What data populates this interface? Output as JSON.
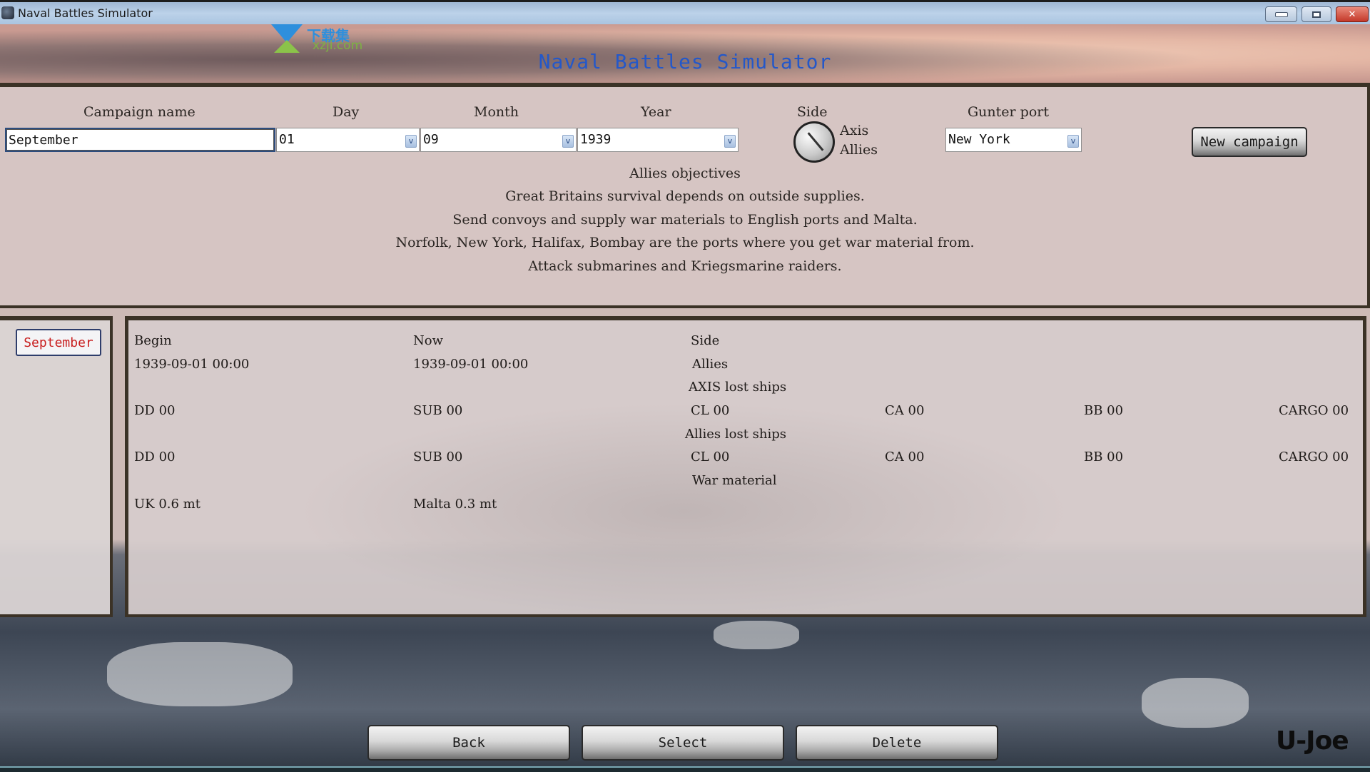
{
  "window": {
    "title": "Naval Battles Simulator",
    "controls": {
      "minimize": "minimize",
      "maximize": "maximize",
      "close": "✕"
    }
  },
  "watermark": {
    "chinese": "下载集",
    "url": "xzji.com"
  },
  "app_title": "Naval Battles Simulator",
  "campaign_form": {
    "labels": {
      "campaign_name": "Campaign name",
      "day": "Day",
      "month": "Month",
      "year": "Year",
      "side": "Side",
      "gunter_port": "Gunter port"
    },
    "campaign_name_value": "September",
    "day_value": "01",
    "month_value": "09",
    "year_value": "1939",
    "side_options": [
      "Axis",
      "Allies"
    ],
    "side_selected": "Allies",
    "gunter_port_value": "New York",
    "dropdown_glyph": "v",
    "new_campaign_label": "New campaign"
  },
  "objectives": {
    "heading": "Allies objectives",
    "lines": [
      "Great Britains survival depends on outside supplies.",
      "Send convoys and supply war materials to English ports and Malta.",
      "Norfolk, New York, Halifax, Bombay are the ports where you get war material from.",
      "Attack  submarines and Kriegsmarine raiders."
    ]
  },
  "campaign_list": [
    {
      "name": "September",
      "selected": true
    }
  ],
  "details": {
    "begin_label": "Begin",
    "now_label": "Now",
    "side_label": "Side",
    "begin_value": "1939-09-01  00:00",
    "now_value": "1939-09-01  00:00",
    "side_value": "Allies",
    "axis_lost_heading": "AXIS lost ships",
    "axis_lost": [
      "DD 00",
      "SUB 00",
      "CL 00",
      "CA 00",
      "BB 00",
      "CARGO 00"
    ],
    "allies_lost_heading": "Allies lost ships",
    "allies_lost": [
      "DD 00",
      "SUB 00",
      "CL 00",
      "CA 00",
      "BB 00",
      "CARGO 00"
    ],
    "war_material_heading": "War material",
    "war_material": [
      "UK 0.6 mt",
      "Malta 0.3 mt"
    ]
  },
  "buttons": {
    "back": "Back",
    "select": "Select",
    "delete": "Delete"
  },
  "author": "U-Joe"
}
